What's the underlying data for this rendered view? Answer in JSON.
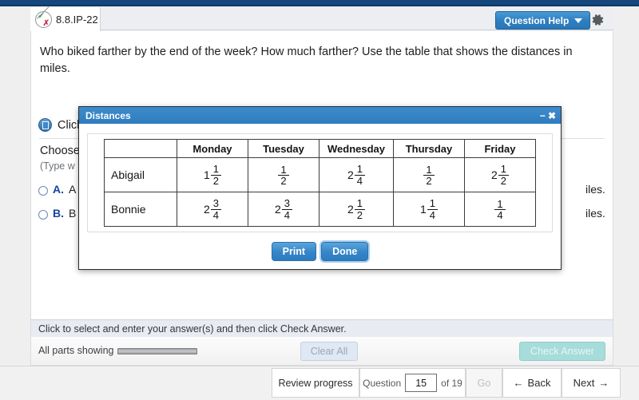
{
  "topbar": {
    "tab_label": "8.8.IP-22",
    "score_icon": "check-x-circle-icon",
    "question_help_label": "Question Help",
    "caret_icon": "chevron-down-icon",
    "gear_icon": "gear-icon",
    "accent_blue": "#2f7fc0",
    "strip_blue": "#16477c"
  },
  "question": {
    "text": "Who biked farther by the end of the week? How much farther? Use the table that shows the distances in miles.",
    "popup_icon": "popup-table-icon",
    "popup_link_text": "Click on the icon to view the distances in miles.",
    "choose_text": "Choose",
    "type_hint": "(Type w",
    "options": [
      {
        "letter": "A.",
        "text": "A",
        "tail": "iles."
      },
      {
        "letter": "B.",
        "text": "B",
        "tail": "iles."
      }
    ]
  },
  "hintbar": {
    "text": "Click to select and enter your answer(s) and then click Check Answer."
  },
  "actionbar": {
    "parts_label": "All parts showing",
    "clear_all_label": "Clear All",
    "check_answer_label": "Check Answer",
    "progress_icon": "progress-bar"
  },
  "bottomnav": {
    "review_label": "Review progress",
    "question_word": "Question",
    "question_number": "15",
    "of_label": "of 19",
    "go_label": "Go",
    "back_label": "Back",
    "back_icon": "arrow-left-icon",
    "next_label": "Next",
    "next_icon": "arrow-right-icon"
  },
  "dialog": {
    "title": "Distances",
    "minimize_icon": "minimize-icon",
    "close_icon": "close-icon",
    "print_label": "Print",
    "done_label": "Done",
    "table": {
      "corner": "",
      "columns": [
        "Monday",
        "Tuesday",
        "Wednesday",
        "Thursday",
        "Friday"
      ],
      "rows": [
        {
          "name": "Abigail",
          "values": [
            {
              "whole": "1",
              "num": "1",
              "den": "2"
            },
            {
              "whole": "",
              "num": "1",
              "den": "2"
            },
            {
              "whole": "2",
              "num": "1",
              "den": "4"
            },
            {
              "whole": "",
              "num": "1",
              "den": "2"
            },
            {
              "whole": "2",
              "num": "1",
              "den": "2"
            }
          ]
        },
        {
          "name": "Bonnie",
          "values": [
            {
              "whole": "2",
              "num": "3",
              "den": "4"
            },
            {
              "whole": "2",
              "num": "3",
              "den": "4"
            },
            {
              "whole": "2",
              "num": "1",
              "den": "2"
            },
            {
              "whole": "1",
              "num": "1",
              "den": "4"
            },
            {
              "whole": "",
              "num": "1",
              "den": "4"
            }
          ]
        }
      ]
    }
  }
}
